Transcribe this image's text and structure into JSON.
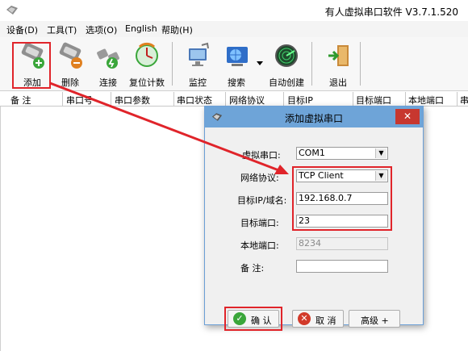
{
  "window": {
    "title": "有人虚拟串口软件 V3.7.1.520"
  },
  "menu": {
    "items": [
      "设备(D)",
      "工具(T)",
      "选项(O)",
      "English",
      "帮助(H)"
    ]
  },
  "toolbar": {
    "add": "添加",
    "delete": "删除",
    "connect": "连接",
    "reset_count": "复位计数",
    "monitor": "监控",
    "search": "搜索",
    "auto_create": "自动创建",
    "exit": "退出"
  },
  "columns": [
    "备 注",
    "串口号",
    "串口参数",
    "串口状态",
    "网络协议",
    "目标IP",
    "目标端口",
    "本地端口",
    "串"
  ],
  "dialog": {
    "title": "添加虚拟串口",
    "close": "✕",
    "labels": {
      "virtual_port": "虚拟串口:",
      "protocol": "网络协议:",
      "target_ip": "目标IP/域名:",
      "target_port": "目标端口:",
      "local_port": "本地端口:",
      "note": "备  注:"
    },
    "values": {
      "virtual_port": "COM1",
      "protocol": "TCP Client",
      "target_ip": "192.168.0.7",
      "target_port": "23",
      "local_port": "8234",
      "note": ""
    },
    "buttons": {
      "ok": "确 认",
      "cancel": "取 消",
      "advanced": "高级 +"
    }
  },
  "colors": {
    "highlight": "#e0242a",
    "dialog_title_bg": "#6ea4d8",
    "close_bg": "#c7372f"
  }
}
